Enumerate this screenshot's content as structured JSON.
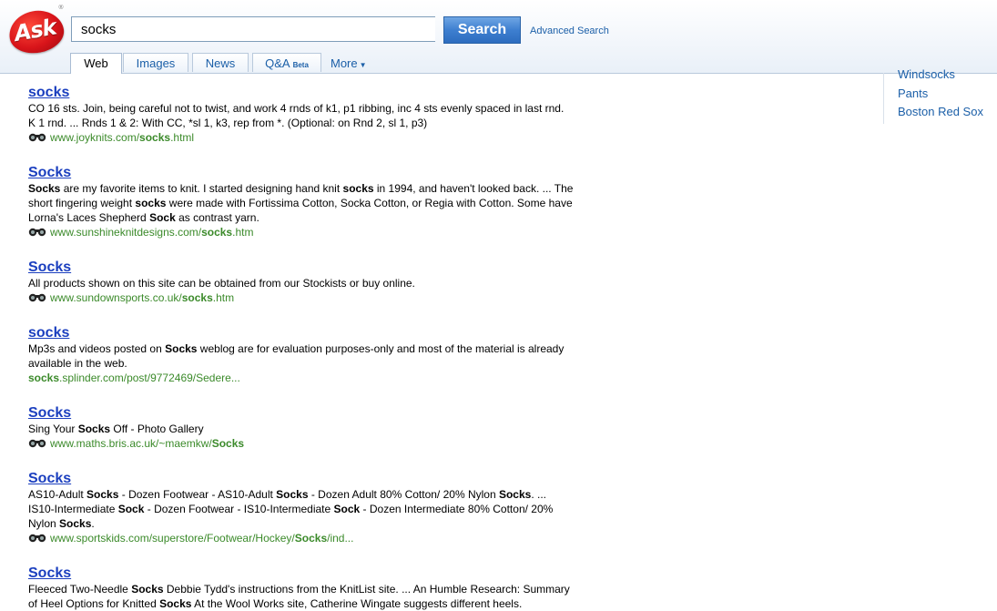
{
  "header": {
    "logo_text": "Ask",
    "logo_tm": "®",
    "search_value": "socks",
    "search_button": "Search",
    "advanced_search": "Advanced Search",
    "tabs": [
      {
        "label": "Web",
        "active": true
      },
      {
        "label": "Images",
        "active": false
      },
      {
        "label": "News",
        "active": false
      },
      {
        "label": "Q&A",
        "badge": "Beta",
        "active": false
      }
    ],
    "more_label": "More"
  },
  "sidebar": {
    "items": [
      "Windsocks",
      "Pants",
      "Boston Red Sox"
    ]
  },
  "results": [
    {
      "title": "socks",
      "snippet_lines": [
        [
          {
            "t": "CO 16 sts. Join, being careful not to twist, and work 4 rnds of k1, p1 ribbing, inc 4 sts evenly spaced in last rnd."
          }
        ],
        [
          {
            "t": "K 1 rnd. ... Rnds 1 & 2: With CC, *sl 1, k3, rep from *. (Optional: on Rnd 2, sl 1, p3)"
          }
        ]
      ],
      "url": [
        {
          "t": "www.joyknits.com/"
        },
        {
          "t": "socks",
          "b": true
        },
        {
          "t": ".html"
        }
      ],
      "preview_icon": true
    },
    {
      "title": "Socks",
      "snippet_lines": [
        [
          {
            "t": "Socks",
            "b": true
          },
          {
            "t": " are my favorite items to knit. I started designing hand knit "
          },
          {
            "t": "socks",
            "b": true
          },
          {
            "t": " in 1994, and haven't looked back. ... The"
          }
        ],
        [
          {
            "t": "short fingering weight "
          },
          {
            "t": "socks",
            "b": true
          },
          {
            "t": " were made with Fortissima Cotton, Socka Cotton, or Regia with Cotton. Some have"
          }
        ],
        [
          {
            "t": "Lorna's Laces Shepherd "
          },
          {
            "t": "Sock",
            "b": true
          },
          {
            "t": " as contrast yarn."
          }
        ]
      ],
      "url": [
        {
          "t": "www.sunshineknitdesigns.com/"
        },
        {
          "t": "socks",
          "b": true
        },
        {
          "t": ".htm"
        }
      ],
      "preview_icon": true
    },
    {
      "title": "Socks",
      "snippet_lines": [
        [
          {
            "t": "All products shown on this site can be obtained from our Stockists or buy online."
          }
        ]
      ],
      "url": [
        {
          "t": "www.sundownsports.co.uk/"
        },
        {
          "t": "socks",
          "b": true
        },
        {
          "t": ".htm"
        }
      ],
      "preview_icon": true
    },
    {
      "title": "socks",
      "snippet_lines": [
        [
          {
            "t": "Mp3s and videos posted on "
          },
          {
            "t": "Socks",
            "b": true
          },
          {
            "t": " weblog are for evaluation purposes-only and most of the material is already"
          }
        ],
        [
          {
            "t": "available in the web."
          }
        ]
      ],
      "url": [
        {
          "t": "socks",
          "b": true
        },
        {
          "t": ".splinder.com/post/9772469/Sedere..."
        }
      ],
      "preview_icon": false
    },
    {
      "title": "Socks",
      "snippet_lines": [
        [
          {
            "t": "Sing Your "
          },
          {
            "t": "Socks",
            "b": true
          },
          {
            "t": " Off - Photo Gallery"
          }
        ]
      ],
      "url": [
        {
          "t": "www.maths.bris.ac.uk/~maemkw/"
        },
        {
          "t": "Socks",
          "b": true
        }
      ],
      "preview_icon": true
    },
    {
      "title": "Socks",
      "snippet_lines": [
        [
          {
            "t": "AS10-Adult "
          },
          {
            "t": "Socks",
            "b": true
          },
          {
            "t": " - Dozen Footwear - AS10-Adult "
          },
          {
            "t": "Socks",
            "b": true
          },
          {
            "t": " - Dozen Adult 80% Cotton/ 20% Nylon "
          },
          {
            "t": "Socks",
            "b": true
          },
          {
            "t": ". ..."
          }
        ],
        [
          {
            "t": "IS10-Intermediate "
          },
          {
            "t": "Sock",
            "b": true
          },
          {
            "t": " - Dozen Footwear - IS10-Intermediate "
          },
          {
            "t": "Sock",
            "b": true
          },
          {
            "t": " - Dozen Intermediate 80% Cotton/ 20%"
          }
        ],
        [
          {
            "t": "Nylon "
          },
          {
            "t": "Socks",
            "b": true
          },
          {
            "t": "."
          }
        ]
      ],
      "url": [
        {
          "t": "www.sportskids.com/superstore/Footwear/Hockey/"
        },
        {
          "t": "Socks",
          "b": true
        },
        {
          "t": "/ind..."
        }
      ],
      "preview_icon": true
    },
    {
      "title": "Socks",
      "snippet_lines": [
        [
          {
            "t": "Fleeced Two-Needle "
          },
          {
            "t": "Socks",
            "b": true
          },
          {
            "t": " Debbie Tydd's instructions from the KnitList site. ... An Humble Research: Summary"
          }
        ],
        [
          {
            "t": "of Heel Options for Knitted "
          },
          {
            "t": "Socks",
            "b": true
          },
          {
            "t": " At the Wool Works site, Catherine Wingate suggests different heels."
          }
        ]
      ],
      "url": [],
      "preview_icon": false
    }
  ],
  "colors": {
    "title_link": "#1b3fbf",
    "url_green": "#3b8a2a",
    "nav_link": "#1b5fa8",
    "search_button": "#3e7fd0",
    "logo_red": "#d8141a"
  },
  "icons": {
    "preview": "binoculars-icon",
    "more_caret": "caret-down-icon"
  }
}
